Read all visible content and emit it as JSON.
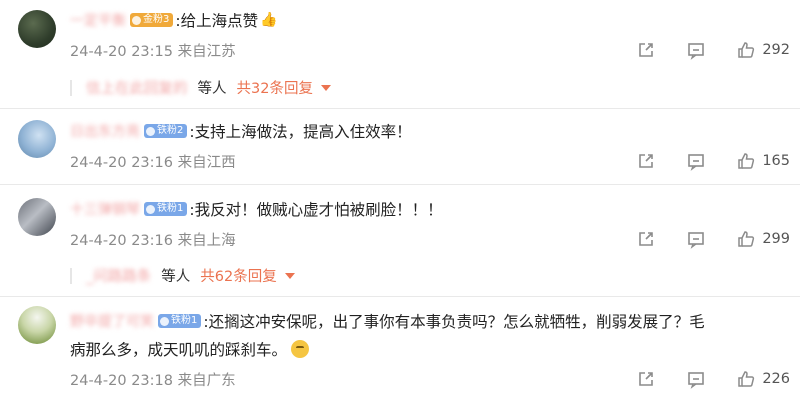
{
  "comments": [
    {
      "username": "一定平衡",
      "badge_label": "金粉3",
      "badge_color": "#f0a93a",
      "text": ":给上海点赞",
      "emoji": "👍",
      "time": "24-4-20 23:15",
      "location": "来自江苏",
      "likes": "292",
      "reply_preview": {
        "user": "信上在此回复的",
        "label": "等人",
        "count_text": "共32条回复"
      }
    },
    {
      "username": "日出东方亮",
      "badge_label": "铁粉2",
      "badge_color": "#7aa7e8",
      "text": ":支持上海做法，提高入住效率！",
      "time": "24-4-20 23:16",
      "location": "来自江西",
      "likes": "165"
    },
    {
      "username": "十三弹钢琴",
      "badge_label": "铁粉1",
      "badge_color": "#7aa7e8",
      "text": ":我反对！做贼心虚才怕被刷脸！！！",
      "time": "24-4-20 23:16",
      "location": "来自上海",
      "likes": "299",
      "reply_preview": {
        "user": "_问路路条",
        "label": "等人",
        "count_text": "共62条回复"
      }
    },
    {
      "username": "野卒提了可笑",
      "badge_label": "铁粉1",
      "badge_color": "#7aa7e8",
      "text_line1": ":还搁这冲安保呢，出了事你有本事负责吗？怎么就牺牲，削弱发展了？毛",
      "text_line2": "病那么多，成天叽叽的踩刹车。",
      "time": "24-4-20 23:18",
      "location": "来自广东",
      "likes": "226"
    }
  ],
  "icons": {
    "share": "share-icon",
    "comment": "comment-icon",
    "like": "thumbs-up-icon",
    "caret": "caret-down-icon",
    "emoji": "shh-face-emoji"
  },
  "colors": {
    "accent": "#eb7350",
    "username": "#f2a6a6",
    "meta": "#8a8a8a",
    "gold_badge": "#f0a93a",
    "blue_badge": "#7aa7e8"
  }
}
